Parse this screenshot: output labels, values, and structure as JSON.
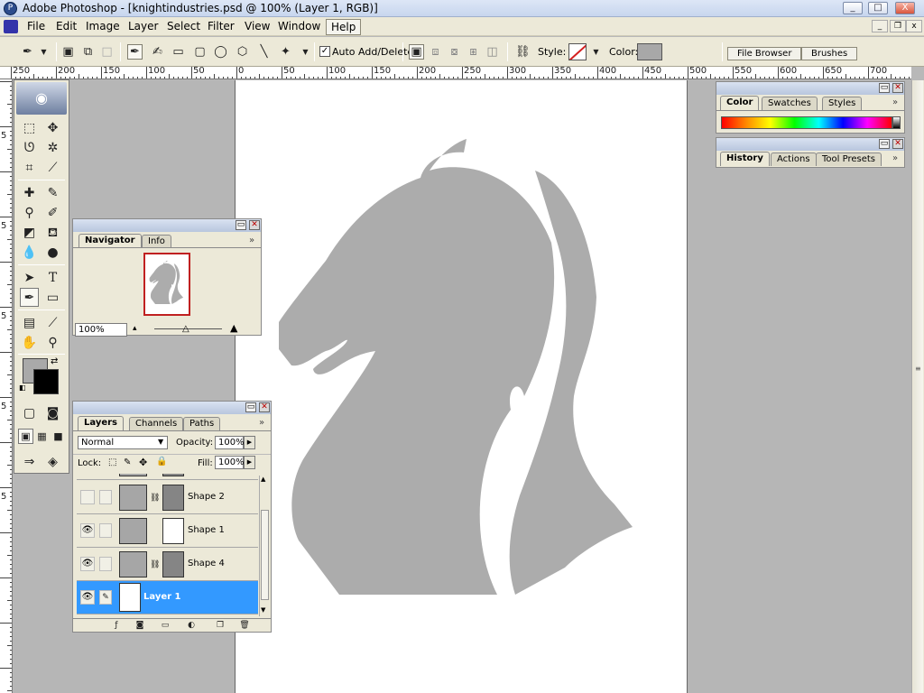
{
  "window": {
    "title": "Adobe Photoshop - [knightindustries.psd @ 100% (Layer 1, RGB)]",
    "minimize": "_",
    "maximize": "□",
    "close": "X"
  },
  "menu": {
    "items": [
      "File",
      "Edit",
      "Image",
      "Layer",
      "Select",
      "Filter",
      "View",
      "Window",
      "Help"
    ],
    "active": "Help"
  },
  "options": {
    "auto_add_delete_label": "Auto Add/Delete",
    "auto_add_delete_checked": "✓",
    "style_label": "Style:",
    "color_label": "Color:",
    "color_value": "#a8a8a8",
    "well_tabs": [
      "File Browser",
      "Brushes"
    ]
  },
  "ruler": {
    "h_labels": [
      "250",
      "200",
      "150",
      "100",
      "50",
      "0",
      "50",
      "100",
      "150",
      "200",
      "250",
      "300",
      "350",
      "400",
      "450",
      "500",
      "550",
      "600",
      "650",
      "700"
    ],
    "v_labels": [
      "5",
      "5",
      "5",
      "5",
      "5"
    ]
  },
  "icons": {
    "pen": "pen-icon",
    "shape_layer": "shape-layers-icon",
    "paths": "paths-icon",
    "fill_pixels": "fill-pixels-icon",
    "freeform_pen": "freeform-pen-icon",
    "rectangle": "rectangle-icon",
    "rounded_rect": "rounded-rectangle-icon",
    "ellipse": "ellipse-icon",
    "polygon": "polygon-icon",
    "line": "line-icon",
    "custom_shape": "custom-shape-icon"
  },
  "navigator": {
    "tabs": [
      "Navigator",
      "Info"
    ],
    "zoom": "100%"
  },
  "color_palette": {
    "tabs": [
      "Color",
      "Swatches",
      "Styles"
    ]
  },
  "history_palette": {
    "tabs": [
      "History",
      "Actions",
      "Tool Presets"
    ]
  },
  "layers": {
    "tabs": [
      "Layers",
      "Channels",
      "Paths"
    ],
    "blend_mode": "Normal",
    "opacity_label": "Opacity:",
    "opacity": "100%",
    "lock_label": "Lock:",
    "fill_label": "Fill:",
    "fill": "100%",
    "rows": [
      {
        "name": "Shape 2",
        "visible": false
      },
      {
        "name": "Shape 1",
        "visible": true
      },
      {
        "name": "Shape 4",
        "visible": true
      },
      {
        "name": "Layer 1",
        "visible": true,
        "selected": true
      }
    ]
  },
  "canvas": {
    "logo_color": "#acacac"
  }
}
